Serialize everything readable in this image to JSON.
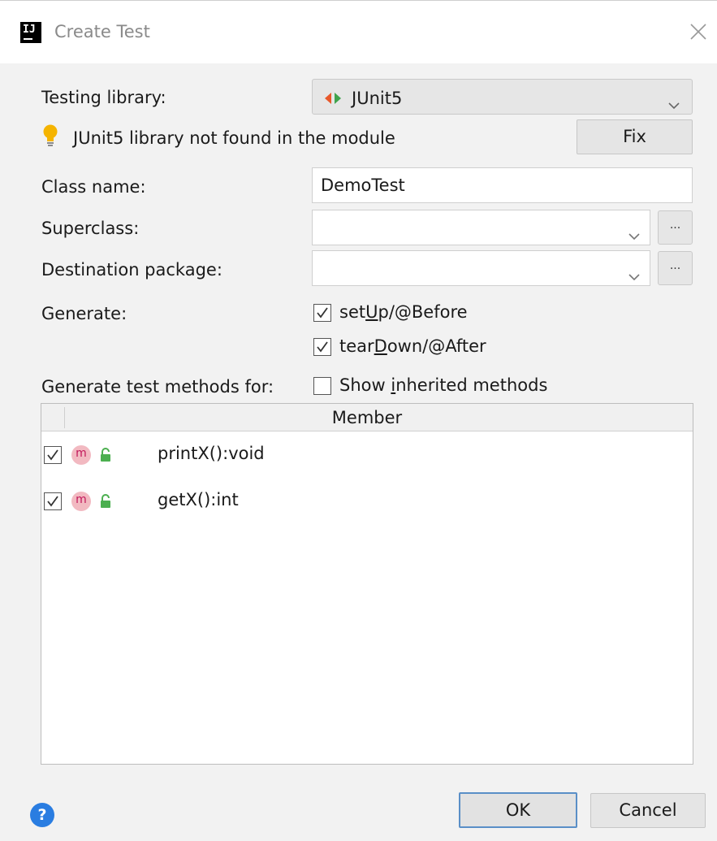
{
  "window": {
    "title": "Create Test",
    "app_icon_text": "IJ"
  },
  "form": {
    "testing_library_label": "Testing library:",
    "testing_library_value": "JUnit5",
    "warning_text": "JUnit5 library not found in the module",
    "fix_label": "Fix",
    "class_name_label": "Class name:",
    "class_name_value": "DemoTest",
    "superclass_label": "Superclass:",
    "superclass_value": "",
    "destination_label": "Destination package:",
    "destination_value": "",
    "ellipsis_label": "...",
    "generate_label": "Generate:",
    "setup": {
      "pre": "set",
      "mnemonic": "U",
      "post": "p/@Before",
      "checked": true
    },
    "teardown": {
      "pre": "tear",
      "mnemonic": "D",
      "post": "own/@After",
      "checked": true
    },
    "methods_for_label": "Generate test methods for:",
    "show_inherited": {
      "pre": "Show ",
      "mnemonic": "i",
      "post": "nherited methods",
      "checked": false
    }
  },
  "table": {
    "column_header": "Member",
    "method_icon_text": "m",
    "rows": [
      {
        "method": "printX():void",
        "checked": true
      },
      {
        "method": "getX():int",
        "checked": true
      }
    ]
  },
  "footer": {
    "help_label": "?",
    "ok_label": "OK",
    "cancel_label": "Cancel"
  },
  "colors": {
    "primary_border": "#5a8fc7",
    "help_blue": "#2a7de1",
    "method_badge": "#f2b9c1",
    "lock_green": "#4caf50",
    "bulb_yellow": "#f5b400"
  }
}
